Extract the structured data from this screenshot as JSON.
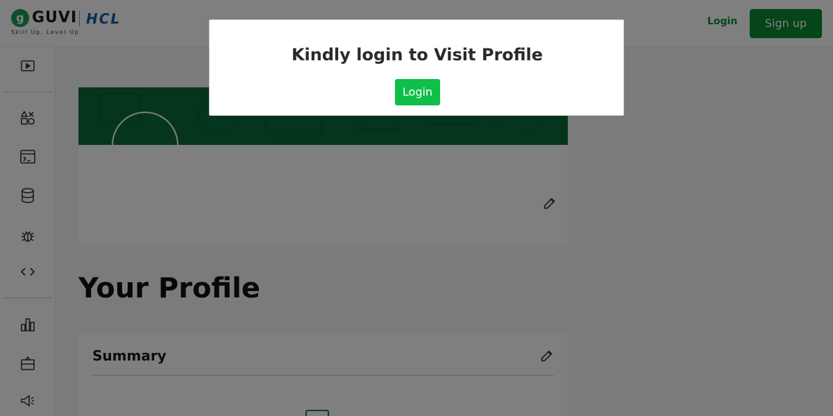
{
  "header": {
    "logo_text": "GUVI",
    "logo_tagline": "Skill Up. Level Up",
    "partner_logo": "HCL",
    "login_label": "Login",
    "signup_label": "Sign up"
  },
  "sidebar": {
    "icons": [
      "play-icon",
      "shapes-icon",
      "terminal-icon",
      "database-icon",
      "bug-icon",
      "code-icon",
      "bar-chart-icon",
      "certificate-icon",
      "megaphone-icon"
    ]
  },
  "main": {
    "heading": "Your Profile",
    "summary_title": "Summary"
  },
  "modal": {
    "title": "Kindly login to Visit Profile",
    "login_label": "Login"
  },
  "colors": {
    "brand_green": "#0a8a2e",
    "banner_green": "#0d6b3a",
    "modal_button": "#0fbf4a",
    "overlay": "rgba(0,0,0,0.5)"
  }
}
